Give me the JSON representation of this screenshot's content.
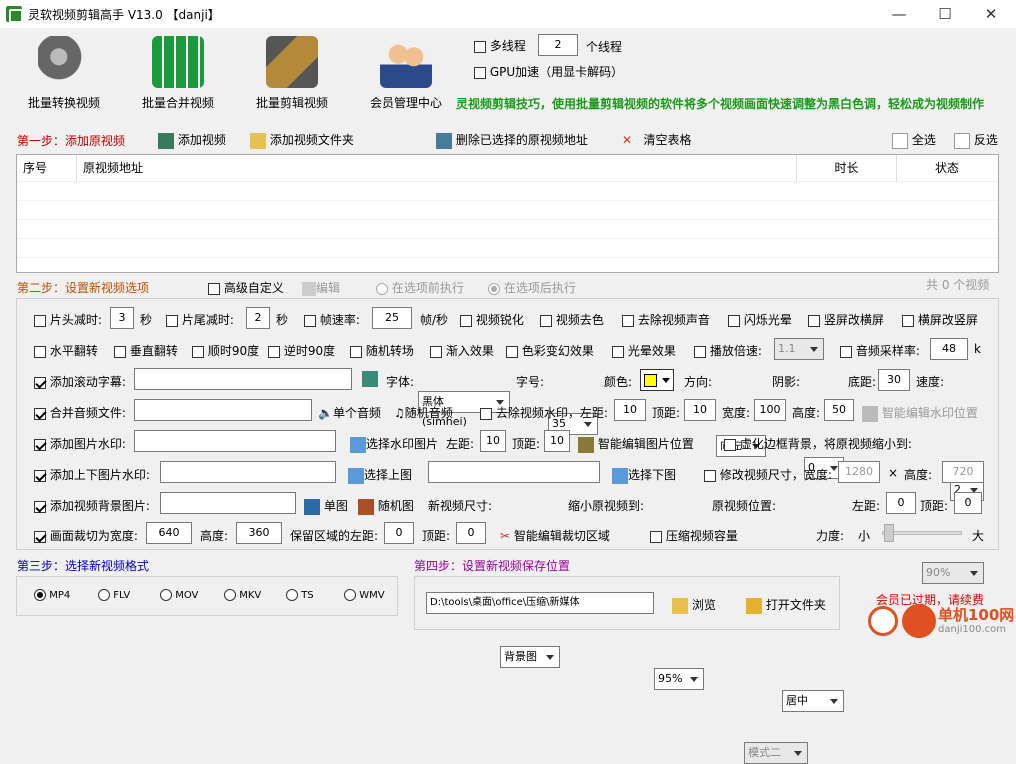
{
  "window": {
    "title": "灵软视频剪辑高手 V13.0  【danji】",
    "min": "—",
    "max": "☐",
    "close": "✕"
  },
  "toolbar": {
    "batch_convert": "批量转换视频",
    "batch_merge": "批量合并视频",
    "batch_cut": "批量剪辑视频",
    "member": "会员管理中心"
  },
  "threads": {
    "label": "多线程",
    "value": "2",
    "unit": "个线程",
    "gpu": "GPU加速（用显卡解码）"
  },
  "marquee": "灵视频剪辑技巧，使用批量剪辑视频的软件将多个视频画面快速调整为黑白色调，轻松成为视频制作",
  "step1": {
    "title": "第一步：添加原视频",
    "add": "添加视频",
    "add_folder": "添加视频文件夹",
    "delete": "删除已选择的原视频地址",
    "clear": "清空表格",
    "select_all": "全选",
    "invert": "反选"
  },
  "table": {
    "columns": [
      "序号",
      "原视频地址",
      "时长",
      "状态"
    ]
  },
  "step2": {
    "title": "第二步：设置新视频选项",
    "advanced": "高级自定义",
    "edit": "编辑",
    "before": "在选项前执行",
    "after": "在选项后执行",
    "count": "共 0 个视频"
  },
  "row1": {
    "head_cut": "片头减时:",
    "head_val": "3",
    "sec1": "秒",
    "tail_cut": "片尾减时:",
    "tail_val": "2",
    "sec2": "秒",
    "fps": "帧速率:",
    "fps_val": "25",
    "fps_unit": "帧/秒",
    "sharpen": "视频锐化",
    "decolor": "视频去色",
    "mute": "去除视频声音",
    "flash": "闪烁光晕",
    "v2h": "竖屏改横屏",
    "h2v": "横屏改竖屏"
  },
  "row2": {
    "hflip": "水平翻转",
    "vflip": "垂直翻转",
    "cw90": "顺时90度",
    "ccw90": "逆时90度",
    "random_trans": "随机转场",
    "fade": "渐入效果",
    "color": "色彩变幻效果",
    "glow": "光晕效果",
    "speed": "播放倍速:",
    "speed_val": "1.1",
    "sample": "音频采样率:",
    "sample_val": "48",
    "sample_unit": "k"
  },
  "row3": {
    "subtitle": "添加滚动字幕:",
    "font": "字体:",
    "font_val": "黑体 (simhei)",
    "size": "字号:",
    "size_val": "35",
    "color": "颜色:",
    "dir": "方向:",
    "dir_val": "向左",
    "shadow": "阴影:",
    "shadow_val": "0",
    "bottom": "底距:",
    "bottom_val": "30",
    "speedl": "速度:",
    "speed_val": "2",
    "color_hex": "#ffff00"
  },
  "row4": {
    "audio": "合并音频文件:",
    "single": "单个音频",
    "random": "随机音频",
    "rm_wm": "去除视频水印，左距:",
    "left": "10",
    "top_l": "顶距:",
    "top": "10",
    "width_l": "宽度:",
    "width": "100",
    "height_l": "高度:",
    "height": "50",
    "smart": "智能编辑水印位置"
  },
  "row5": {
    "img_wm": "添加图片水印:",
    "choose": "选择水印图片",
    "left_l": "左距:",
    "left": "10",
    "top_l": "顶距:",
    "top": "10",
    "smart": "智能编辑图片位置",
    "blur": "虚化边框背景，将原视频缩小到:",
    "blur_val": "90%"
  },
  "row6": {
    "tb_wm": "添加上下图片水印:",
    "up": "选择上图",
    "down": "选择下图",
    "resize": "修改视频尺寸，宽度:",
    "w": "1280",
    "x": "×",
    "h_l": "高度:",
    "h": "720"
  },
  "row7": {
    "bg": "添加视频背景图片:",
    "single": "单图",
    "random": "随机图",
    "newsize": "新视频尺寸:",
    "newsize_val": "背景图",
    "shrink": "缩小原视频到:",
    "shrink_val": "95%",
    "pos": "原视频位置:",
    "pos_val": "居中",
    "left_l": "左距:",
    "left": "0",
    "top_l": "顶距:",
    "top": "0"
  },
  "row8": {
    "crop": "画面裁切为宽度:",
    "w": "640",
    "h_l": "高度:",
    "h": "360",
    "keep": "保留区域的左距:",
    "left": "0",
    "top_l": "顶距:",
    "top": "0",
    "smart": "智能编辑裁切区域",
    "compress": "压缩视频容量",
    "mode": "模式二",
    "strength": "力度:",
    "small": "小",
    "large": "大"
  },
  "step3": {
    "title": "第三步：选择新视频格式",
    "formats": [
      "MP4",
      "FLV",
      "MOV",
      "MKV",
      "TS",
      "WMV"
    ]
  },
  "step4": {
    "title": "第四步：设置新视频保存位置",
    "path": "D:\\tools\\桌面\\office\\压缩\\新媒体",
    "browse": "浏览",
    "open": "打开文件夹"
  },
  "expired": "会员已过期，请续费",
  "watermark": {
    "site": "单机100网",
    "url": "danji100.com"
  }
}
